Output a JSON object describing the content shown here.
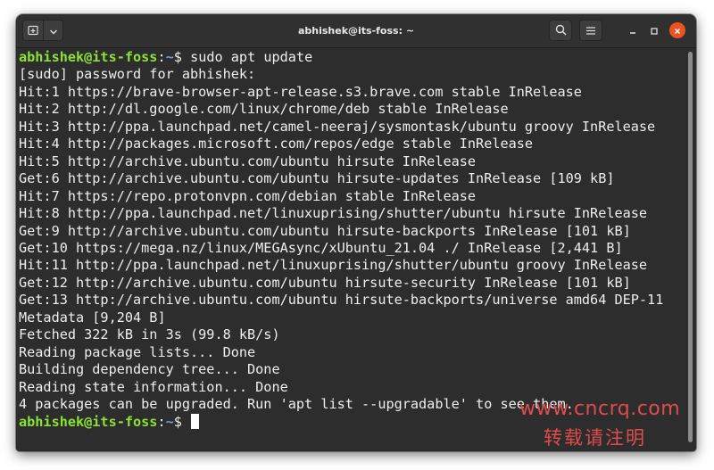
{
  "window": {
    "title": "abhishek@its-foss: ~"
  },
  "icons": {
    "new_tab": "new-tab-icon",
    "dropdown": "chevron-down-icon",
    "search": "search-icon",
    "menu": "hamburger-menu-icon",
    "minimize": "minimize-icon",
    "maximize": "maximize-icon",
    "close": "close-icon"
  },
  "colors": {
    "prompt_user": "#8ae234",
    "prompt_path": "#729fcf",
    "close_button": "#e95420",
    "terminal_bg": "#2d2d2d"
  },
  "terminal": {
    "prompt_user": "abhishek@its-foss",
    "prompt_sep": ":",
    "prompt_path": "~",
    "prompt_dollar": "$ ",
    "command": "sudo apt update",
    "output": [
      "[sudo] password for abhishek:",
      "Hit:1 https://brave-browser-apt-release.s3.brave.com stable InRelease",
      "Hit:2 http://dl.google.com/linux/chrome/deb stable InRelease",
      "Hit:3 http://ppa.launchpad.net/camel-neeraj/sysmontask/ubuntu groovy InRelease",
      "Hit:4 http://packages.microsoft.com/repos/edge stable InRelease",
      "Hit:5 http://archive.ubuntu.com/ubuntu hirsute InRelease",
      "Get:6 http://archive.ubuntu.com/ubuntu hirsute-updates InRelease [109 kB]",
      "Hit:7 https://repo.protonvpn.com/debian stable InRelease",
      "Hit:8 http://ppa.launchpad.net/linuxuprising/shutter/ubuntu hirsute InRelease",
      "Get:9 http://archive.ubuntu.com/ubuntu hirsute-backports InRelease [101 kB]",
      "Get:10 https://mega.nz/linux/MEGAsync/xUbuntu_21.04 ./ InRelease [2,441 B]",
      "Hit:11 http://ppa.launchpad.net/linuxuprising/shutter/ubuntu groovy InRelease",
      "Get:12 http://archive.ubuntu.com/ubuntu hirsute-security InRelease [101 kB]",
      "Get:13 http://archive.ubuntu.com/ubuntu hirsute-backports/universe amd64 DEP-11",
      "Metadata [9,204 B]",
      "Fetched 322 kB in 3s (99.8 kB/s)",
      "Reading package lists... Done",
      "Building dependency tree... Done",
      "Reading state information... Done",
      "4 packages can be upgraded. Run 'apt list --upgradable' to see them."
    ]
  },
  "watermark": {
    "url": "www.cncrq.com",
    "text": "转载请注明"
  }
}
